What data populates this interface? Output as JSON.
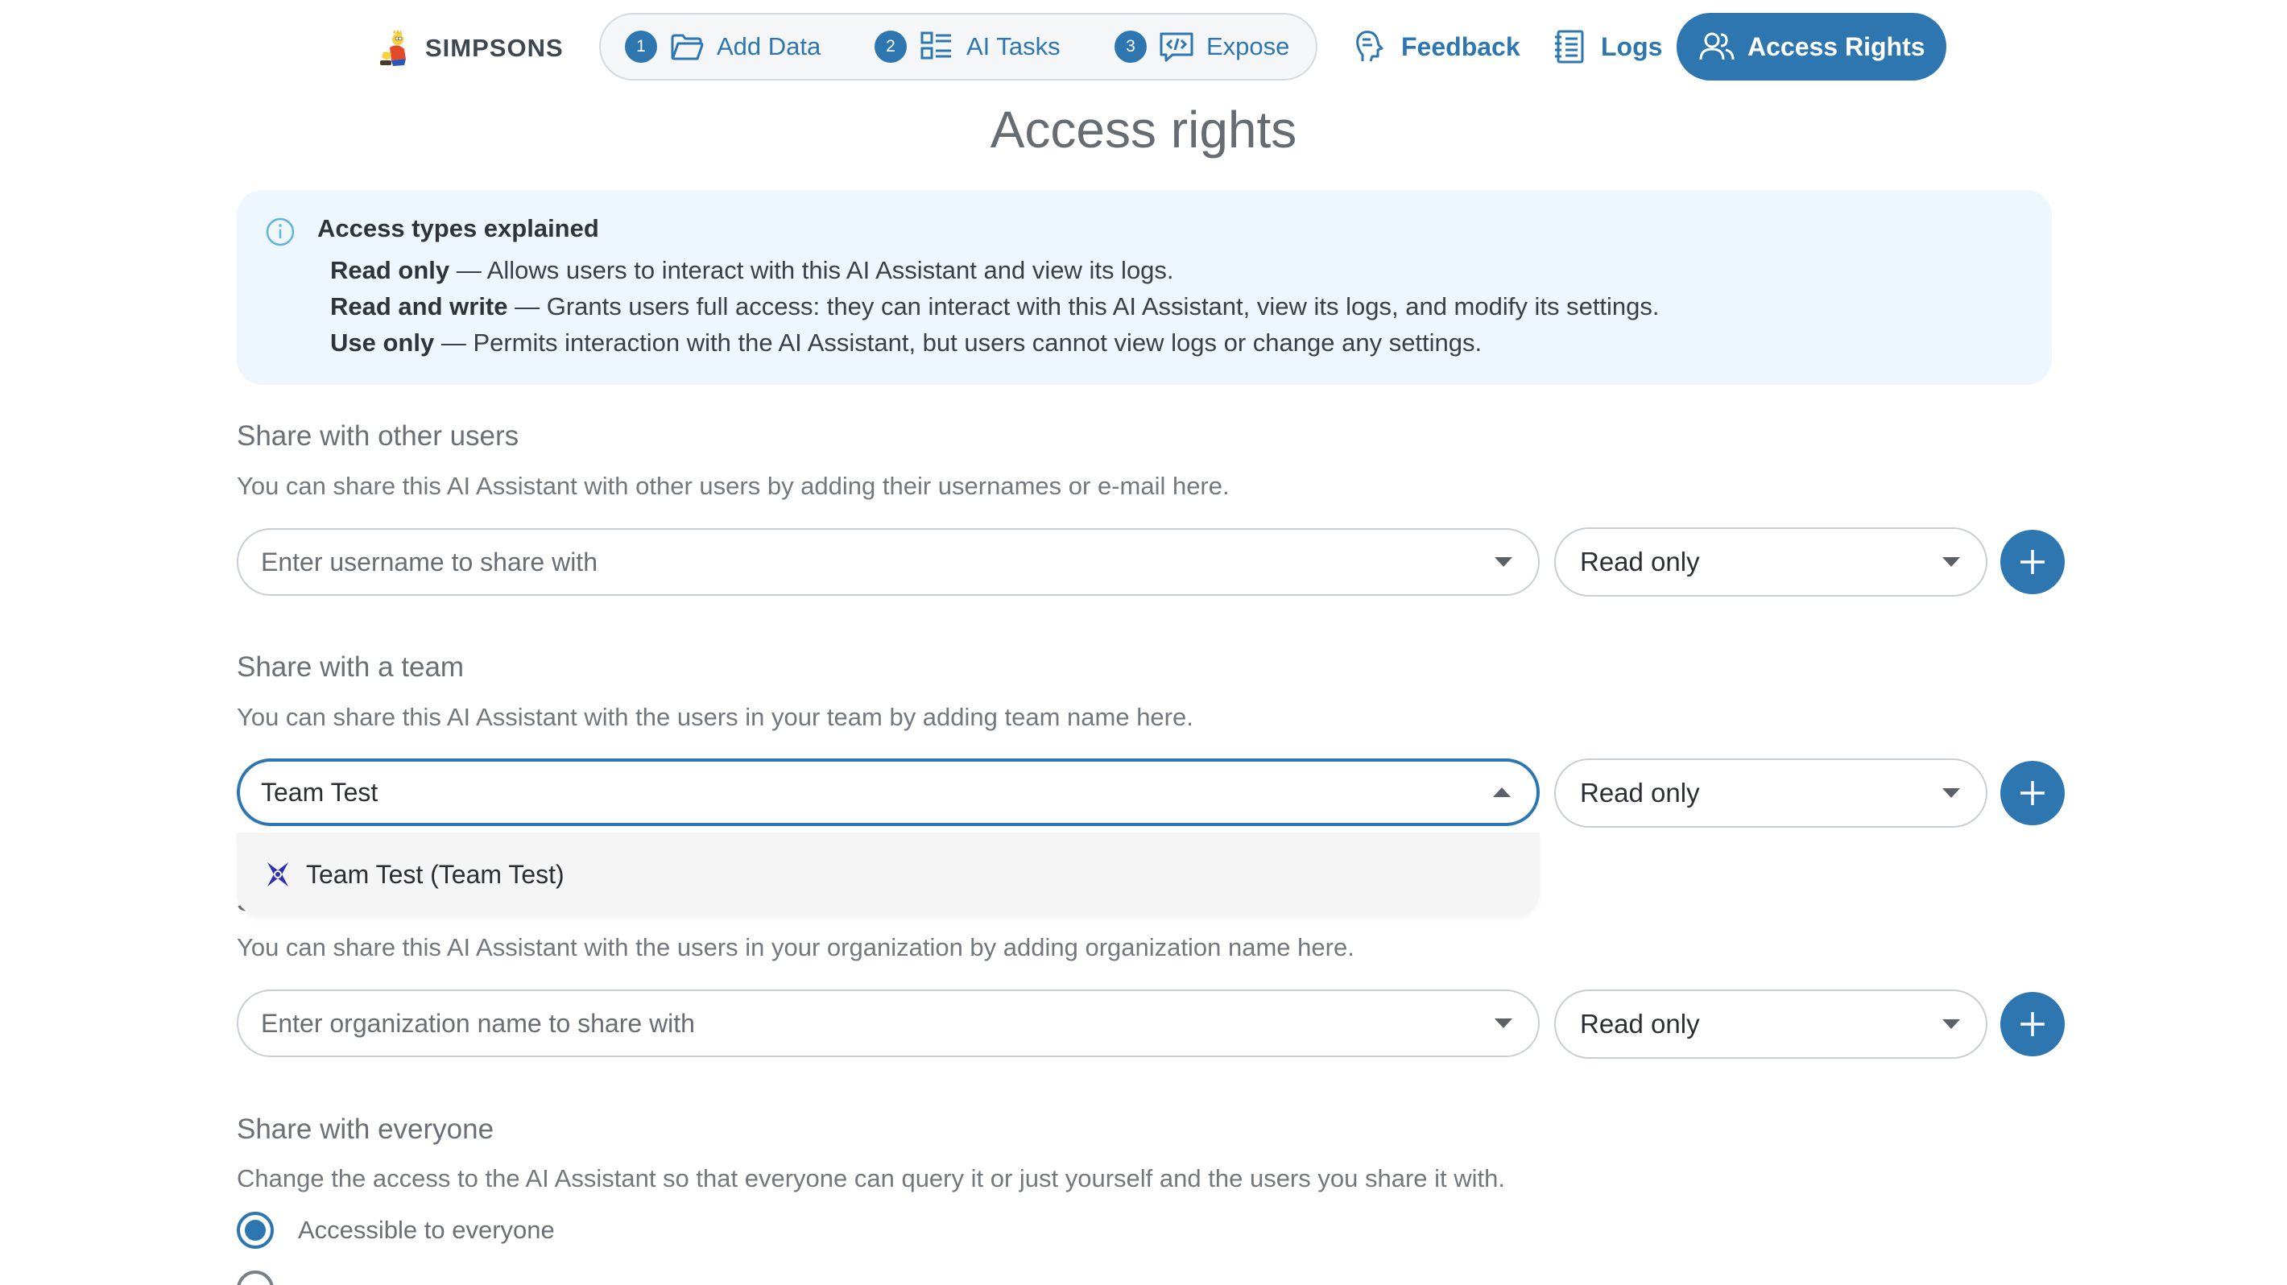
{
  "brand": {
    "name": "SIMPSONS",
    "logo_icon": "simpsons-character-logo-icon"
  },
  "steps": [
    {
      "number": "1",
      "label": "Add Data",
      "icon": "folder-icon"
    },
    {
      "number": "2",
      "label": "AI Tasks",
      "icon": "task-list-icon"
    },
    {
      "number": "3",
      "label": "Expose",
      "icon": "code-bubble-icon"
    }
  ],
  "nav": {
    "feedback": "Feedback",
    "logs": "Logs",
    "access_rights": "Access Rights"
  },
  "colors": {
    "accent": "#2e76b0",
    "info_bg": "#eef7fd",
    "border": "#c9ced4"
  },
  "page_title": "Access rights",
  "info": {
    "title": "Access types explained",
    "items": [
      {
        "term": "Read only",
        "text": " — Allows users to interact with this AI Assistant and view its logs."
      },
      {
        "term": "Read and write",
        "text": " — Grants users full access: they can interact with this AI Assistant, view its logs, and modify its settings."
      },
      {
        "term": "Use only",
        "text": " — Permits interaction with the AI Assistant, but users cannot view logs or change any settings."
      }
    ]
  },
  "share_users": {
    "title": "Share with other users",
    "description": "You can share this AI Assistant with other users by adding their usernames or e-mail here.",
    "placeholder": "Enter username to share with",
    "access": "Read only"
  },
  "share_team": {
    "title": "Share with a team",
    "description": "You can share this AI Assistant with the users in your team by adding team name here.",
    "value": "Team Test",
    "access": "Read only",
    "dropdown_option": "Team Test (Team Test)"
  },
  "share_org": {
    "title_partial": "S",
    "description": "You can share this AI Assistant with the users in your organization by adding organization name here.",
    "placeholder": "Enter organization name to share with",
    "access": "Read only"
  },
  "share_everyone": {
    "title": "Share with everyone",
    "description": "Change the access to the AI Assistant so that everyone can query it or just yourself and the users you share it with.",
    "option_everyone": "Accessible to everyone",
    "option_selected": "everyone"
  }
}
